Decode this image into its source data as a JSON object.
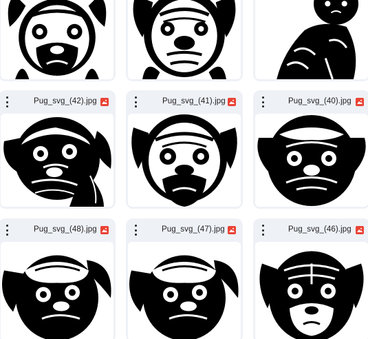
{
  "files": [
    {
      "name": "",
      "icon": "image-file-icon"
    },
    {
      "name": "",
      "icon": "image-file-icon"
    },
    {
      "name": "",
      "icon": "image-file-icon"
    },
    {
      "name": "Pug_svg_(42).jpg",
      "icon": "image-file-icon"
    },
    {
      "name": "Pug_svg_(41).jpg",
      "icon": "image-file-icon"
    },
    {
      "name": "Pug_svg_(40).jpg",
      "icon": "image-file-icon"
    },
    {
      "name": "Pug_svg_(48).jpg",
      "icon": "image-file-icon"
    },
    {
      "name": "Pug_svg_(47).jpg",
      "icon": "image-file-icon"
    },
    {
      "name": "Pug_svg_(46).jpg",
      "icon": "image-file-icon"
    }
  ],
  "colors": {
    "card_bg": "#eef1f6",
    "image_icon": "#ea4335",
    "text": "#1f1f1f"
  }
}
